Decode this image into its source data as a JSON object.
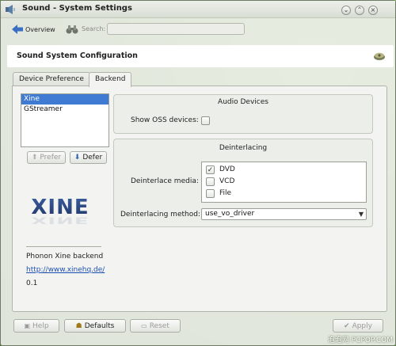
{
  "window": {
    "title": "Sound - System Settings"
  },
  "toolbar": {
    "overview_label": "Overview",
    "search_label": "Search:",
    "search_value": ""
  },
  "header": {
    "title": "Sound System Configuration"
  },
  "tabs": [
    {
      "label": "Device Preference",
      "active": false
    },
    {
      "label": "Backend",
      "active": true
    }
  ],
  "backends": {
    "items": [
      {
        "label": "Xine",
        "selected": true
      },
      {
        "label": "GStreamer",
        "selected": false
      }
    ],
    "prefer_label": "Prefer",
    "defer_label": "Defer"
  },
  "backend_info": {
    "logo_text": "XINE",
    "description": "Phonon Xine backend",
    "url": "http://www.xinehq.de/",
    "version": "0.1"
  },
  "audio_devices": {
    "title": "Audio Devices",
    "show_oss_label": "Show OSS devices:",
    "show_oss_checked": false
  },
  "deinterlacing": {
    "title": "Deinterlacing",
    "media_label": "Deinterlace media:",
    "media": [
      {
        "label": "DVD",
        "checked": true
      },
      {
        "label": "VCD",
        "checked": false
      },
      {
        "label": "File",
        "checked": false
      }
    ],
    "method_label": "Deinterlacing method:",
    "method_value": "use_vo_driver"
  },
  "footer": {
    "help_label": "Help",
    "defaults_label": "Defaults",
    "reset_label": "Reset",
    "apply_label": "Apply"
  },
  "watermark": "泡泡网 PCPOP.COM",
  "colors": {
    "selection": "#3f7bd2",
    "link": "#1d4fb3",
    "wallpaper": "#6ea03b"
  }
}
